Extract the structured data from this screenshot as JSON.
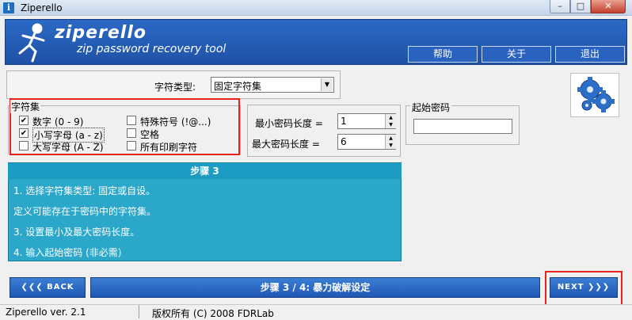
{
  "window": {
    "title": "Ziperello",
    "min_glyph": "–",
    "max_glyph": "□",
    "close_glyph": "✕"
  },
  "header": {
    "brand": "ziperello",
    "tagline": "zip password recovery tool",
    "buttons": {
      "help": "帮助",
      "about": "关于",
      "exit": "退出"
    },
    "color": "#2360b9"
  },
  "charset_type": {
    "label": "字符类型:",
    "selected": "固定字符集"
  },
  "charset_group": {
    "label": "字符集",
    "options": [
      {
        "label": "数字 (0 - 9)",
        "checked": true
      },
      {
        "label": "小写字母 (a - z)",
        "checked": true
      },
      {
        "label": "大写字母 (A - Z)",
        "checked": false
      },
      {
        "label": "特殊符号 (!@...)",
        "checked": false
      },
      {
        "label": "空格",
        "checked": false
      },
      {
        "label": "所有印刷字符",
        "checked": false
      }
    ]
  },
  "length": {
    "min_label": "最小密码长度 =",
    "min_value": "1",
    "max_label": "最大密码长度 =",
    "max_value": "6"
  },
  "start_password": {
    "label": "起始密码",
    "value": ""
  },
  "step_info": {
    "title": "步骤 3",
    "lines": [
      "1. 选择字符集类型: 固定或自设。",
      "定义可能存在于密码中的字符集。",
      "3. 设置最小及最大密码长度。",
      "4. 输入起始密码 (非必需)"
    ],
    "color": "#2aa7c9"
  },
  "nav": {
    "back": "BACK",
    "back_chevrons": "❮❮❮",
    "banner": "步骤 3 / 4: 暴力破解设定",
    "next": "NEXT",
    "next_chevrons": "❯❯❯"
  },
  "status": {
    "version": "Ziperello ver. 2.1",
    "copyright": "版权所有 (C) 2008 FDRLab"
  },
  "icons": {
    "app": "app-icon",
    "gears": "gears-icon",
    "logo": "running-man-logo"
  },
  "highlight_color": "#e8231d"
}
